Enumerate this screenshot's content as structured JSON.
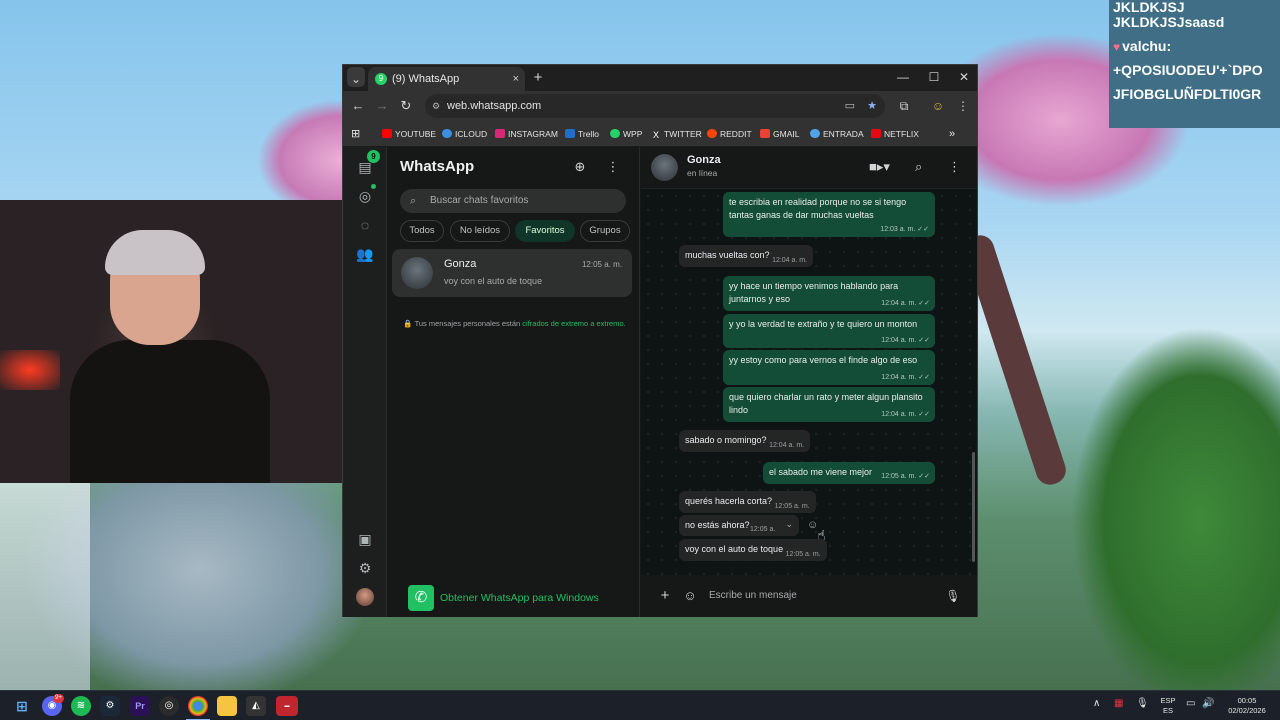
{
  "overlay": {
    "top_fragment": "JKLDKJSJ",
    "line1": "JKLDKJSJsaasd",
    "user": "valchu:",
    "line3": "+QPOSIUODEU'+`DPO",
    "line4": "JFIOBGLUÑFDLTI0GR"
  },
  "browser": {
    "tab_title": "(9) WhatsApp",
    "tab_close": "×",
    "new_tab": "+",
    "url": "web.whatsapp.com",
    "window_controls": {
      "minimize": "—",
      "maximize": "☐",
      "close": "✕"
    },
    "bookmarks": [
      {
        "label": "YOUTUBE",
        "color": "#ff0000"
      },
      {
        "label": "ICLOUD",
        "color": "#3b8fe0"
      },
      {
        "label": "INSTAGRAM",
        "color": "#d6297a"
      },
      {
        "label": "Trello",
        "color": "#1f6fd1"
      },
      {
        "label": "WPP",
        "color": "#25d366"
      },
      {
        "label": "TWITTER",
        "color": "#ffffff"
      },
      {
        "label": "REDDIT",
        "color": "#ff4500"
      },
      {
        "label": "GMAIL",
        "color": "#ea4335"
      },
      {
        "label": "ENTRADA",
        "color": "#4fa3e8"
      },
      {
        "label": "NETFLIX",
        "color": "#e50914"
      }
    ],
    "more_bookmarks": "»"
  },
  "whatsapp": {
    "title": "WhatsApp",
    "unread_badge": "9",
    "search_placeholder": "Buscar chats favoritos",
    "filters": [
      "Todos",
      "No leídos",
      "Favoritos",
      "Grupos"
    ],
    "active_filter": "Favoritos",
    "chat": {
      "name": "Gonza",
      "time": "12:05 a. m.",
      "preview": "voy con el auto de toque"
    },
    "e2e_text": "🔒 Tus mensajes personales están",
    "e2e_link": "cifrados de extremo a extremo.",
    "get_app": "Obtener WhatsApp para Windows",
    "contact": {
      "name": "Gonza",
      "status": "en línea"
    },
    "composer_placeholder": "Escribe un mensaje",
    "messages": [
      {
        "dir": "out",
        "text": "te escribia en realidad porque no se si tengo tantas ganas de dar muchas vueltas",
        "time": "12:03 a. m. ✓✓"
      },
      {
        "dir": "in",
        "text": "muchas vueltas con?",
        "time": "12:04 a. m."
      },
      {
        "dir": "out",
        "text": "yy hace un tiempo venimos hablando para juntarnos y eso",
        "time": "12:04 a. m. ✓✓"
      },
      {
        "dir": "out",
        "text": "y yo la verdad te extraño y te quiero un monton",
        "time": "12:04 a. m. ✓✓"
      },
      {
        "dir": "out",
        "text": "yy estoy como para vernos el finde algo de eso",
        "time": "12:04 a. m. ✓✓"
      },
      {
        "dir": "out",
        "text": "que quiero charlar un rato y meter algun plansito lindo",
        "time": "12:04 a. m. ✓✓"
      },
      {
        "dir": "in",
        "text": "sabado o momingo?",
        "time": "12:04 a. m."
      },
      {
        "dir": "out",
        "text": "el sabado me viene mejor",
        "time": "12:05 a. m. ✓✓"
      },
      {
        "dir": "in",
        "text": "querés hacerla corta?",
        "time": "12:05 a. m."
      },
      {
        "dir": "in",
        "text": "no estás ahora?",
        "time": "12:05 a."
      },
      {
        "dir": "in",
        "text": "voy con el auto de toque",
        "time": "12:05 a. m."
      }
    ]
  },
  "taskbar": {
    "discord_badge": "9+",
    "lang_top": "ESP",
    "lang_bottom": "ES",
    "clock_time": "00:05",
    "clock_date": "02/02/2026"
  }
}
